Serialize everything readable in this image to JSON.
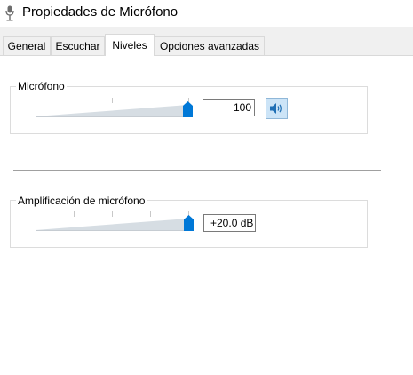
{
  "window": {
    "title": "Propiedades de Micrófono",
    "icon": "microphone-icon"
  },
  "tabs": [
    {
      "label": "General",
      "active": false
    },
    {
      "label": "Escuchar",
      "active": false
    },
    {
      "label": "Niveles",
      "active": true
    },
    {
      "label": "Opciones avanzadas",
      "active": false
    }
  ],
  "levels": {
    "microphone": {
      "label": "Micrófono",
      "value": "100",
      "slider_level_percent": 100,
      "mute_button_icon": "speaker-icon"
    },
    "boost": {
      "label": "Amplificación de micrófono",
      "value": "+20.0 dB",
      "slider_level_percent": 100
    }
  },
  "colors": {
    "accent": "#0078d7",
    "tab_strip_bg": "#f0f0f0",
    "mute_button_bg": "#cce4f7"
  }
}
